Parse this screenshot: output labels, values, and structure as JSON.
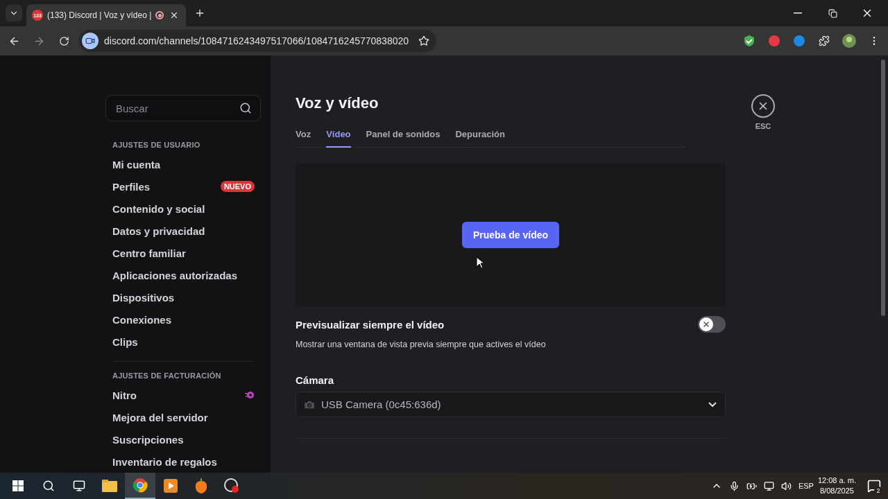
{
  "browser": {
    "tab": {
      "favicon_badge": "133",
      "title": "(133) Discord | Voz y vídeo |"
    },
    "url": "discord.com/channels/1084716243497517066/1084716245770838020"
  },
  "sidebar": {
    "search": {
      "placeholder": "Buscar"
    },
    "sections": [
      {
        "heading": "AJUSTES DE USUARIO",
        "items": [
          {
            "label": "Mi cuenta",
            "kind": "plain"
          },
          {
            "label": "Perfiles",
            "kind": "badge",
            "badge": "NUEVO"
          },
          {
            "label": "Contenido y social",
            "kind": "plain"
          },
          {
            "label": "Datos y privacidad",
            "kind": "plain"
          },
          {
            "label": "Centro familiar",
            "kind": "plain"
          },
          {
            "label": "Aplicaciones autorizadas",
            "kind": "plain"
          },
          {
            "label": "Dispositivos",
            "kind": "plain"
          },
          {
            "label": "Conexiones",
            "kind": "plain"
          },
          {
            "label": "Clips",
            "kind": "plain"
          }
        ]
      },
      {
        "heading": "AJUSTES DE FACTURACIÓN",
        "items": [
          {
            "label": "Nitro",
            "kind": "nitro"
          },
          {
            "label": "Mejora del servidor",
            "kind": "plain"
          },
          {
            "label": "Suscripciones",
            "kind": "plain"
          },
          {
            "label": "Inventario de regalos",
            "kind": "plain"
          }
        ]
      }
    ]
  },
  "main": {
    "title": "Voz y vídeo",
    "close_label": "ESC",
    "tabs": [
      {
        "label": "Voz",
        "selected": false
      },
      {
        "label": "Vídeo",
        "selected": true
      },
      {
        "label": "Panel de sonidos",
        "selected": false
      },
      {
        "label": "Depuración",
        "selected": false
      }
    ],
    "preview_button": "Prueba de vídeo",
    "toggle": {
      "label": "Previsualizar siempre el vídeo",
      "description": "Mostrar una ventana de vista previa siempre que actives el vídeo",
      "on": false
    },
    "camera": {
      "label": "Cámara",
      "value": "USB Camera (0c45:636d)"
    }
  },
  "taskbar": {
    "language": "ESP",
    "time": "12:08 a. m.",
    "date": "8/08/2025",
    "notifications": "2"
  }
}
